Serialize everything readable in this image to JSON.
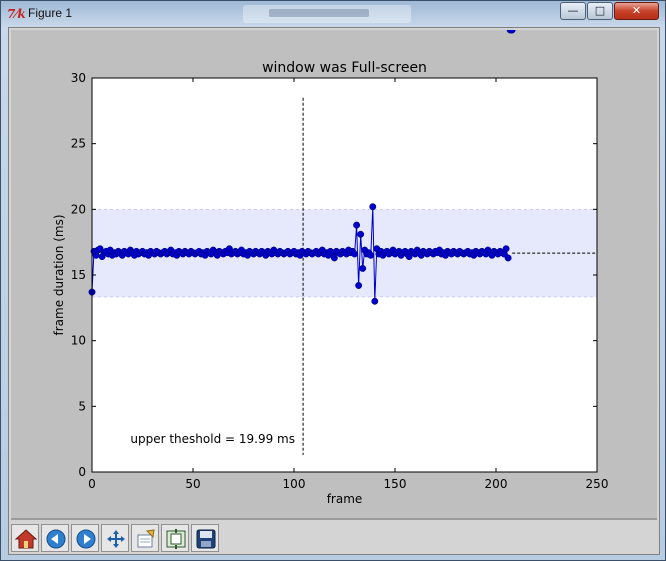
{
  "window": {
    "title": "Figure 1",
    "app_icon_glyph": "7⁄k",
    "minimize_glyph": "—",
    "maximize_glyph": "□",
    "close_glyph": "✕"
  },
  "toolbar": {
    "buttons": [
      {
        "name": "home-icon",
        "label": "Home"
      },
      {
        "name": "back-icon",
        "label": "Back"
      },
      {
        "name": "forward-icon",
        "label": "Forward"
      },
      {
        "name": "pan-icon",
        "label": "Pan"
      },
      {
        "name": "zoom-icon",
        "label": "Zoom"
      },
      {
        "name": "subplots-icon",
        "label": "Subplots"
      },
      {
        "name": "save-icon",
        "label": "Save"
      }
    ]
  },
  "chart_data": {
    "type": "line",
    "title": "window was Full-screen",
    "xlabel": "frame",
    "ylabel": "frame duration (ms)",
    "xlim": [
      0,
      250
    ],
    "ylim": [
      0,
      30
    ],
    "xticks": [
      0,
      50,
      100,
      150,
      200,
      250
    ],
    "yticks": [
      0,
      5,
      10,
      15,
      20,
      25,
      30
    ],
    "grid": false,
    "band": {
      "lower": 13.33,
      "upper": 19.99,
      "color": "#e6e8fc"
    },
    "mean_line": {
      "y": 16.67,
      "x_from": 208,
      "x_to": 250
    },
    "vline": {
      "x": 104.5,
      "y_from": 1.3,
      "y_to": 28.5
    },
    "annotation": {
      "text": "upper theshold = 19.99 ms",
      "x": 19,
      "y": 2.2
    },
    "series_color": "#0000cc",
    "x": [
      0,
      1,
      2,
      3,
      4,
      5,
      6,
      7,
      8,
      9,
      10,
      11,
      12,
      13,
      14,
      15,
      16,
      17,
      18,
      19,
      20,
      21,
      22,
      23,
      24,
      25,
      26,
      27,
      28,
      29,
      30,
      31,
      32,
      33,
      34,
      35,
      36,
      37,
      38,
      39,
      40,
      41,
      42,
      43,
      44,
      45,
      46,
      47,
      48,
      49,
      50,
      51,
      52,
      53,
      54,
      55,
      56,
      57,
      58,
      59,
      60,
      61,
      62,
      63,
      64,
      65,
      66,
      67,
      68,
      69,
      70,
      71,
      72,
      73,
      74,
      75,
      76,
      77,
      78,
      79,
      80,
      81,
      82,
      83,
      84,
      85,
      86,
      87,
      88,
      89,
      90,
      91,
      92,
      93,
      94,
      95,
      96,
      97,
      98,
      99,
      100,
      101,
      102,
      103,
      104,
      105,
      106,
      107,
      108,
      109,
      110,
      111,
      112,
      113,
      114,
      115,
      116,
      117,
      118,
      119,
      120,
      121,
      122,
      123,
      124,
      125,
      126,
      127,
      128,
      129,
      130,
      131,
      132,
      133,
      134,
      135,
      136,
      137,
      138,
      139,
      140,
      141,
      142,
      143,
      144,
      145,
      146,
      147,
      148,
      149,
      150,
      151,
      152,
      153,
      154,
      155,
      156,
      157,
      158,
      159,
      160,
      161,
      162,
      163,
      164,
      165,
      166,
      167,
      168,
      169,
      170,
      171,
      172,
      173,
      174,
      175,
      176,
      177,
      178,
      179,
      180,
      181,
      182,
      183,
      184,
      185,
      186,
      187,
      188,
      189,
      190,
      191,
      192,
      193,
      194,
      195,
      196,
      197,
      198,
      199,
      200,
      201,
      202,
      203,
      204,
      205,
      206,
      207,
      208
    ],
    "y": [
      13.7,
      16.8,
      16.5,
      16.9,
      17.0,
      16.4,
      16.7,
      16.8,
      16.6,
      16.9,
      16.5,
      16.7,
      16.6,
      16.8,
      16.7,
      16.5,
      16.8,
      16.7,
      16.6,
      16.9,
      16.7,
      16.5,
      16.8,
      16.6,
      16.7,
      16.8,
      16.6,
      16.7,
      16.5,
      16.8,
      16.7,
      16.6,
      16.8,
      16.7,
      16.6,
      16.7,
      16.8,
      16.6,
      16.7,
      16.9,
      16.6,
      16.7,
      16.5,
      16.8,
      16.7,
      16.6,
      16.8,
      16.7,
      16.6,
      16.8,
      16.7,
      16.6,
      16.7,
      16.8,
      16.6,
      16.7,
      16.5,
      16.8,
      16.7,
      16.6,
      16.9,
      16.7,
      16.5,
      16.8,
      16.7,
      16.6,
      16.8,
      16.7,
      17.0,
      16.6,
      16.7,
      16.8,
      16.6,
      16.7,
      16.9,
      16.6,
      16.7,
      16.5,
      16.8,
      16.7,
      16.6,
      16.8,
      16.7,
      16.6,
      16.8,
      16.7,
      16.5,
      16.8,
      16.7,
      16.6,
      16.9,
      16.7,
      16.6,
      16.8,
      16.7,
      16.6,
      16.7,
      16.8,
      16.6,
      16.7,
      16.8,
      16.6,
      16.7,
      16.5,
      16.8,
      16.7,
      16.6,
      16.8,
      16.7,
      16.6,
      16.7,
      16.8,
      16.6,
      16.7,
      16.9,
      16.6,
      16.7,
      16.5,
      16.8,
      16.7,
      16.3,
      16.8,
      16.7,
      16.6,
      16.8,
      16.7,
      16.6,
      16.9,
      16.7,
      16.8,
      16.6,
      18.8,
      14.2,
      18.1,
      15.5,
      16.9,
      16.6,
      16.7,
      16.5,
      20.2,
      13.0,
      17.0,
      16.6,
      16.8,
      16.5,
      16.7,
      16.8,
      16.6,
      16.7,
      16.9,
      16.6,
      16.7,
      16.8,
      16.5,
      16.7,
      16.8,
      16.6,
      16.4,
      16.8,
      16.7,
      16.6,
      16.9,
      16.7,
      16.5,
      16.8,
      16.7,
      16.6,
      16.8,
      16.7,
      16.6,
      16.8,
      16.7,
      16.9,
      16.6,
      16.7,
      16.5,
      16.8,
      16.7,
      16.6,
      16.8,
      16.7,
      16.6,
      16.8,
      16.7,
      16.6,
      16.7,
      16.8,
      16.6,
      16.7,
      16.5,
      16.8,
      16.7,
      16.6,
      16.8,
      16.7,
      16.6,
      16.9,
      16.7,
      16.5,
      16.8,
      16.7,
      16.6,
      16.8,
      16.7,
      16.6,
      17.0,
      16.3
    ]
  }
}
